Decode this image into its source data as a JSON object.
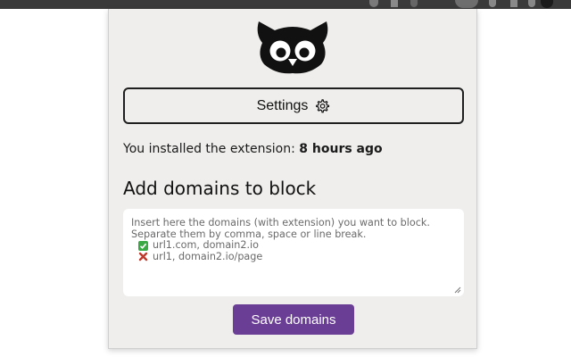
{
  "popup": {
    "settings_button": {
      "label": "Settings",
      "icon": "gear-icon"
    },
    "install_prefix": "You installed the extension: ",
    "install_time": "8 hours ago",
    "heading": "Add domains to block",
    "domains_input": {
      "value": "",
      "placeholder_lines": [
        "Insert here the domains (with extension) you want to block.",
        "Separate them by comma, space or line break."
      ],
      "good_example": "url1.com, domain2.io",
      "bad_example": "url1, domain2.io/page"
    },
    "save_button": {
      "label": "Save domains"
    }
  },
  "colors": {
    "accent": "#6b3e96",
    "popup_background": "#efeeec",
    "check": "#3aa845",
    "cross": "#c0392b"
  }
}
